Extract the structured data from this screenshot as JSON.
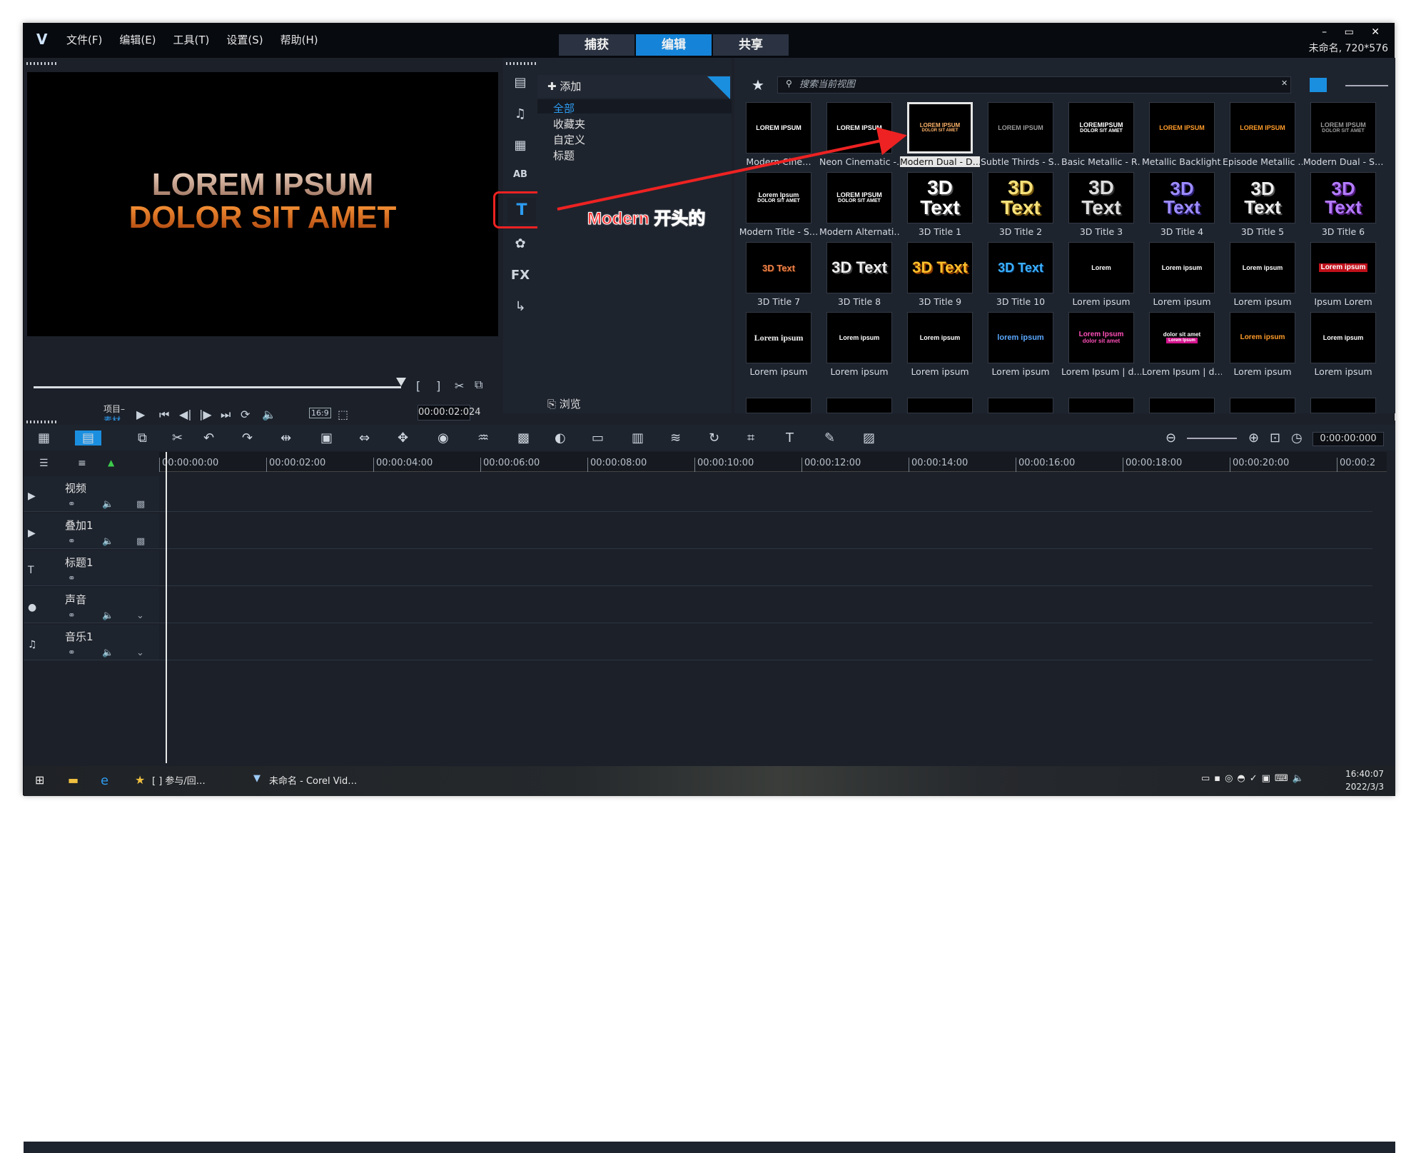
{
  "window": {
    "logo": "V",
    "menus": [
      "文件(F)",
      "编辑(E)",
      "工具(T)",
      "设置(S)",
      "帮助(H)"
    ],
    "steps": [
      "捕获",
      "编辑",
      "共享"
    ],
    "active_step": 1,
    "project_info": "未命名, 720*576",
    "controls": "– ▭ ✕"
  },
  "player": {
    "line1": "LOREM IPSUM",
    "line2": "DOLOR SIT AMET",
    "mode_project": "项目–",
    "mode_clip": "素材–",
    "timecode": "00:00:02:024",
    "aspect": "16:9"
  },
  "library": {
    "add_label": "添加",
    "folders": [
      "全部",
      "收藏夹",
      "自定义",
      "标题"
    ],
    "selected_folder": 0,
    "browse_label": "浏览",
    "side_icons": [
      "media-icon",
      "audio-icon",
      "instant-project-icon",
      "transition-icon",
      "title-icon",
      "graphics-icon",
      "fx-icon",
      "path-icon"
    ],
    "fx_label": "FX",
    "title_label": "T",
    "transition_label": "AB"
  },
  "gallery": {
    "search_placeholder": "搜索当前视图",
    "items": [
      {
        "caption": "Modern Cine…",
        "txt": [
          "LOREM IPSUM"
        ],
        "style": "w"
      },
      {
        "caption": "Neon Cinematic -…",
        "txt": [
          "LOREM IPSUM"
        ],
        "style": "w"
      },
      {
        "caption": "Modern Dual - D…",
        "txt": [
          "LOREM IPSUM",
          "DOLOR SIT AMET"
        ],
        "style": "dual",
        "selected": true
      },
      {
        "caption": "Subtle Thirds - S…",
        "txt": [
          "LOREM IPSUM"
        ],
        "style": "g"
      },
      {
        "caption": "Basic Metallic - R…",
        "txt": [
          "LOREMIPSUM",
          "DOLOR SIT AMET"
        ],
        "style": "w"
      },
      {
        "caption": "Metallic Backlight…",
        "txt": [
          "LOREM IPSUM"
        ],
        "style": "o"
      },
      {
        "caption": "Episode Metallic …",
        "txt": [
          "LOREM IPSUM"
        ],
        "style": "o"
      },
      {
        "caption": "Modern Dual - S…",
        "txt": [
          "LOREM IPSUM",
          "DOLOR SIT AMET"
        ],
        "style": "g"
      },
      {
        "caption": "Modern Title - S…",
        "txt": [
          "Lorem Ipsum",
          "DOLOR SIT AMET"
        ],
        "style": "w"
      },
      {
        "caption": "Modern Alternati…",
        "txt": [
          "LOREM IPSUM",
          "DOLOR SIT AMET"
        ],
        "style": "w"
      },
      {
        "caption": "3D Title 1",
        "txt": [
          "3D Text"
        ],
        "style": "3d1"
      },
      {
        "caption": "3D Title 2",
        "txt": [
          "3D Text"
        ],
        "style": "3d2"
      },
      {
        "caption": "3D Title 3",
        "txt": [
          "3D Text"
        ],
        "style": "3d3"
      },
      {
        "caption": "3D Title 4",
        "txt": [
          "3D Text"
        ],
        "style": "3d4"
      },
      {
        "caption": "3D Title 5",
        "txt": [
          "3D Text"
        ],
        "style": "3d5"
      },
      {
        "caption": "3D Title 6",
        "txt": [
          "3D Text"
        ],
        "style": "3d6"
      },
      {
        "caption": "3D Title 7",
        "txt": [
          "3D Text"
        ],
        "style": "3d7"
      },
      {
        "caption": "3D Title 8",
        "txt": [
          "3D Text"
        ],
        "style": "3d8"
      },
      {
        "caption": "3D Title 9",
        "txt": [
          "3D Text"
        ],
        "style": "3d9"
      },
      {
        "caption": "3D Title 10",
        "txt": [
          "3D Text"
        ],
        "style": "3d10"
      },
      {
        "caption": "Lorem ipsum",
        "txt": [
          "Lorem"
        ],
        "style": "w"
      },
      {
        "caption": "Lorem ipsum",
        "txt": [
          "Lorem ipsum"
        ],
        "style": "w"
      },
      {
        "caption": "Lorem ipsum",
        "txt": [
          "Lorem ipsum"
        ],
        "style": "w"
      },
      {
        "caption": "Ipsum Lorem",
        "txt": [
          "Lorem ipsum"
        ],
        "style": "red"
      },
      {
        "caption": "Lorem ipsum",
        "txt": [
          "Lorem ipsum"
        ],
        "style": "serif"
      },
      {
        "caption": "Lorem ipsum",
        "txt": [
          "Lorem ipsum"
        ],
        "style": "w"
      },
      {
        "caption": "Lorem ipsum",
        "txt": [
          "Lorem ipsum"
        ],
        "style": "w"
      },
      {
        "caption": "Lorem ipsum",
        "txt": [
          "lorem ipsum"
        ],
        "style": "blue"
      },
      {
        "caption": "Lorem Ipsum | d…",
        "txt": [
          "Lorem Ipsum",
          "dolor sit amet"
        ],
        "style": "pink"
      },
      {
        "caption": "Lorem Ipsum | d…",
        "txt": [
          "dolor sit amet",
          "Lorem Ipsum"
        ],
        "style": "bar"
      },
      {
        "caption": "Lorem ipsum",
        "txt": [
          "Lorem ipsum"
        ],
        "style": "oi"
      },
      {
        "caption": "Lorem ipsum",
        "txt": [
          "Lorem ipsum"
        ],
        "style": "w"
      }
    ]
  },
  "annotation": {
    "text": "Modern 开头的"
  },
  "timeline": {
    "timecode": "0:00:00:000",
    "ruler": [
      "00:00:00:00",
      "00:00:02:00",
      "00:00:04:00",
      "00:00:06:00",
      "00:00:08:00",
      "00:00:10:00",
      "00:00:12:00",
      "00:00:14:00",
      "00:00:16:00",
      "00:00:18:00",
      "00:00:20:00",
      "00:00:2"
    ],
    "tracks": [
      {
        "name": "视频",
        "icon": "video-track-icon"
      },
      {
        "name": "叠加1",
        "icon": "overlay-track-icon"
      },
      {
        "name": "标题1",
        "icon": "title-track-icon"
      },
      {
        "name": "声音",
        "icon": "voice-track-icon"
      },
      {
        "name": "音乐1",
        "icon": "music-track-icon"
      }
    ]
  },
  "taskbar": {
    "items": [
      "[       ] 参与/回…",
      "未命名 - Corel Vid…"
    ],
    "time": "16:40:07",
    "date": "2022/3/3"
  }
}
